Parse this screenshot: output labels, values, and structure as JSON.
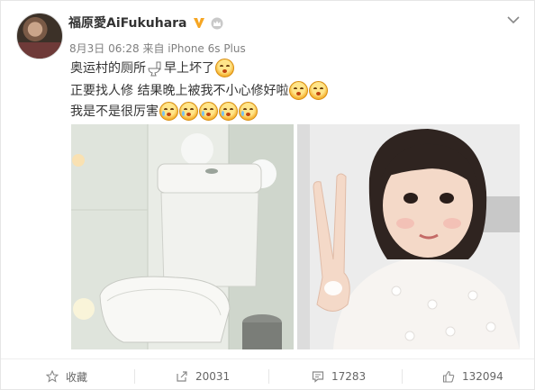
{
  "post": {
    "author_name": "福原愛AiFukuhara",
    "meta": "8月3日 06:28 来自 iPhone 6s Plus",
    "text_line1_a": "奥运村的厕所",
    "text_line1_b": "早上坏了",
    "text_line2": "正要找人修 结果晚上被我不小心修好啦",
    "text_line3": "我是不是很厉害"
  },
  "actions": {
    "favorite_label": "收藏",
    "repost_count": "20031",
    "comment_count": "17283",
    "like_count": "132094"
  },
  "icons": {
    "verified": "verified-v-badge",
    "crown": "member-crown",
    "menu": "chevron-down",
    "star": "star-outline",
    "repost": "share-arrow",
    "comment": "comment-bubble",
    "like": "thumbs-up"
  },
  "colors": {
    "accent_orange": "#f6a623",
    "text_gray": "#808080"
  }
}
